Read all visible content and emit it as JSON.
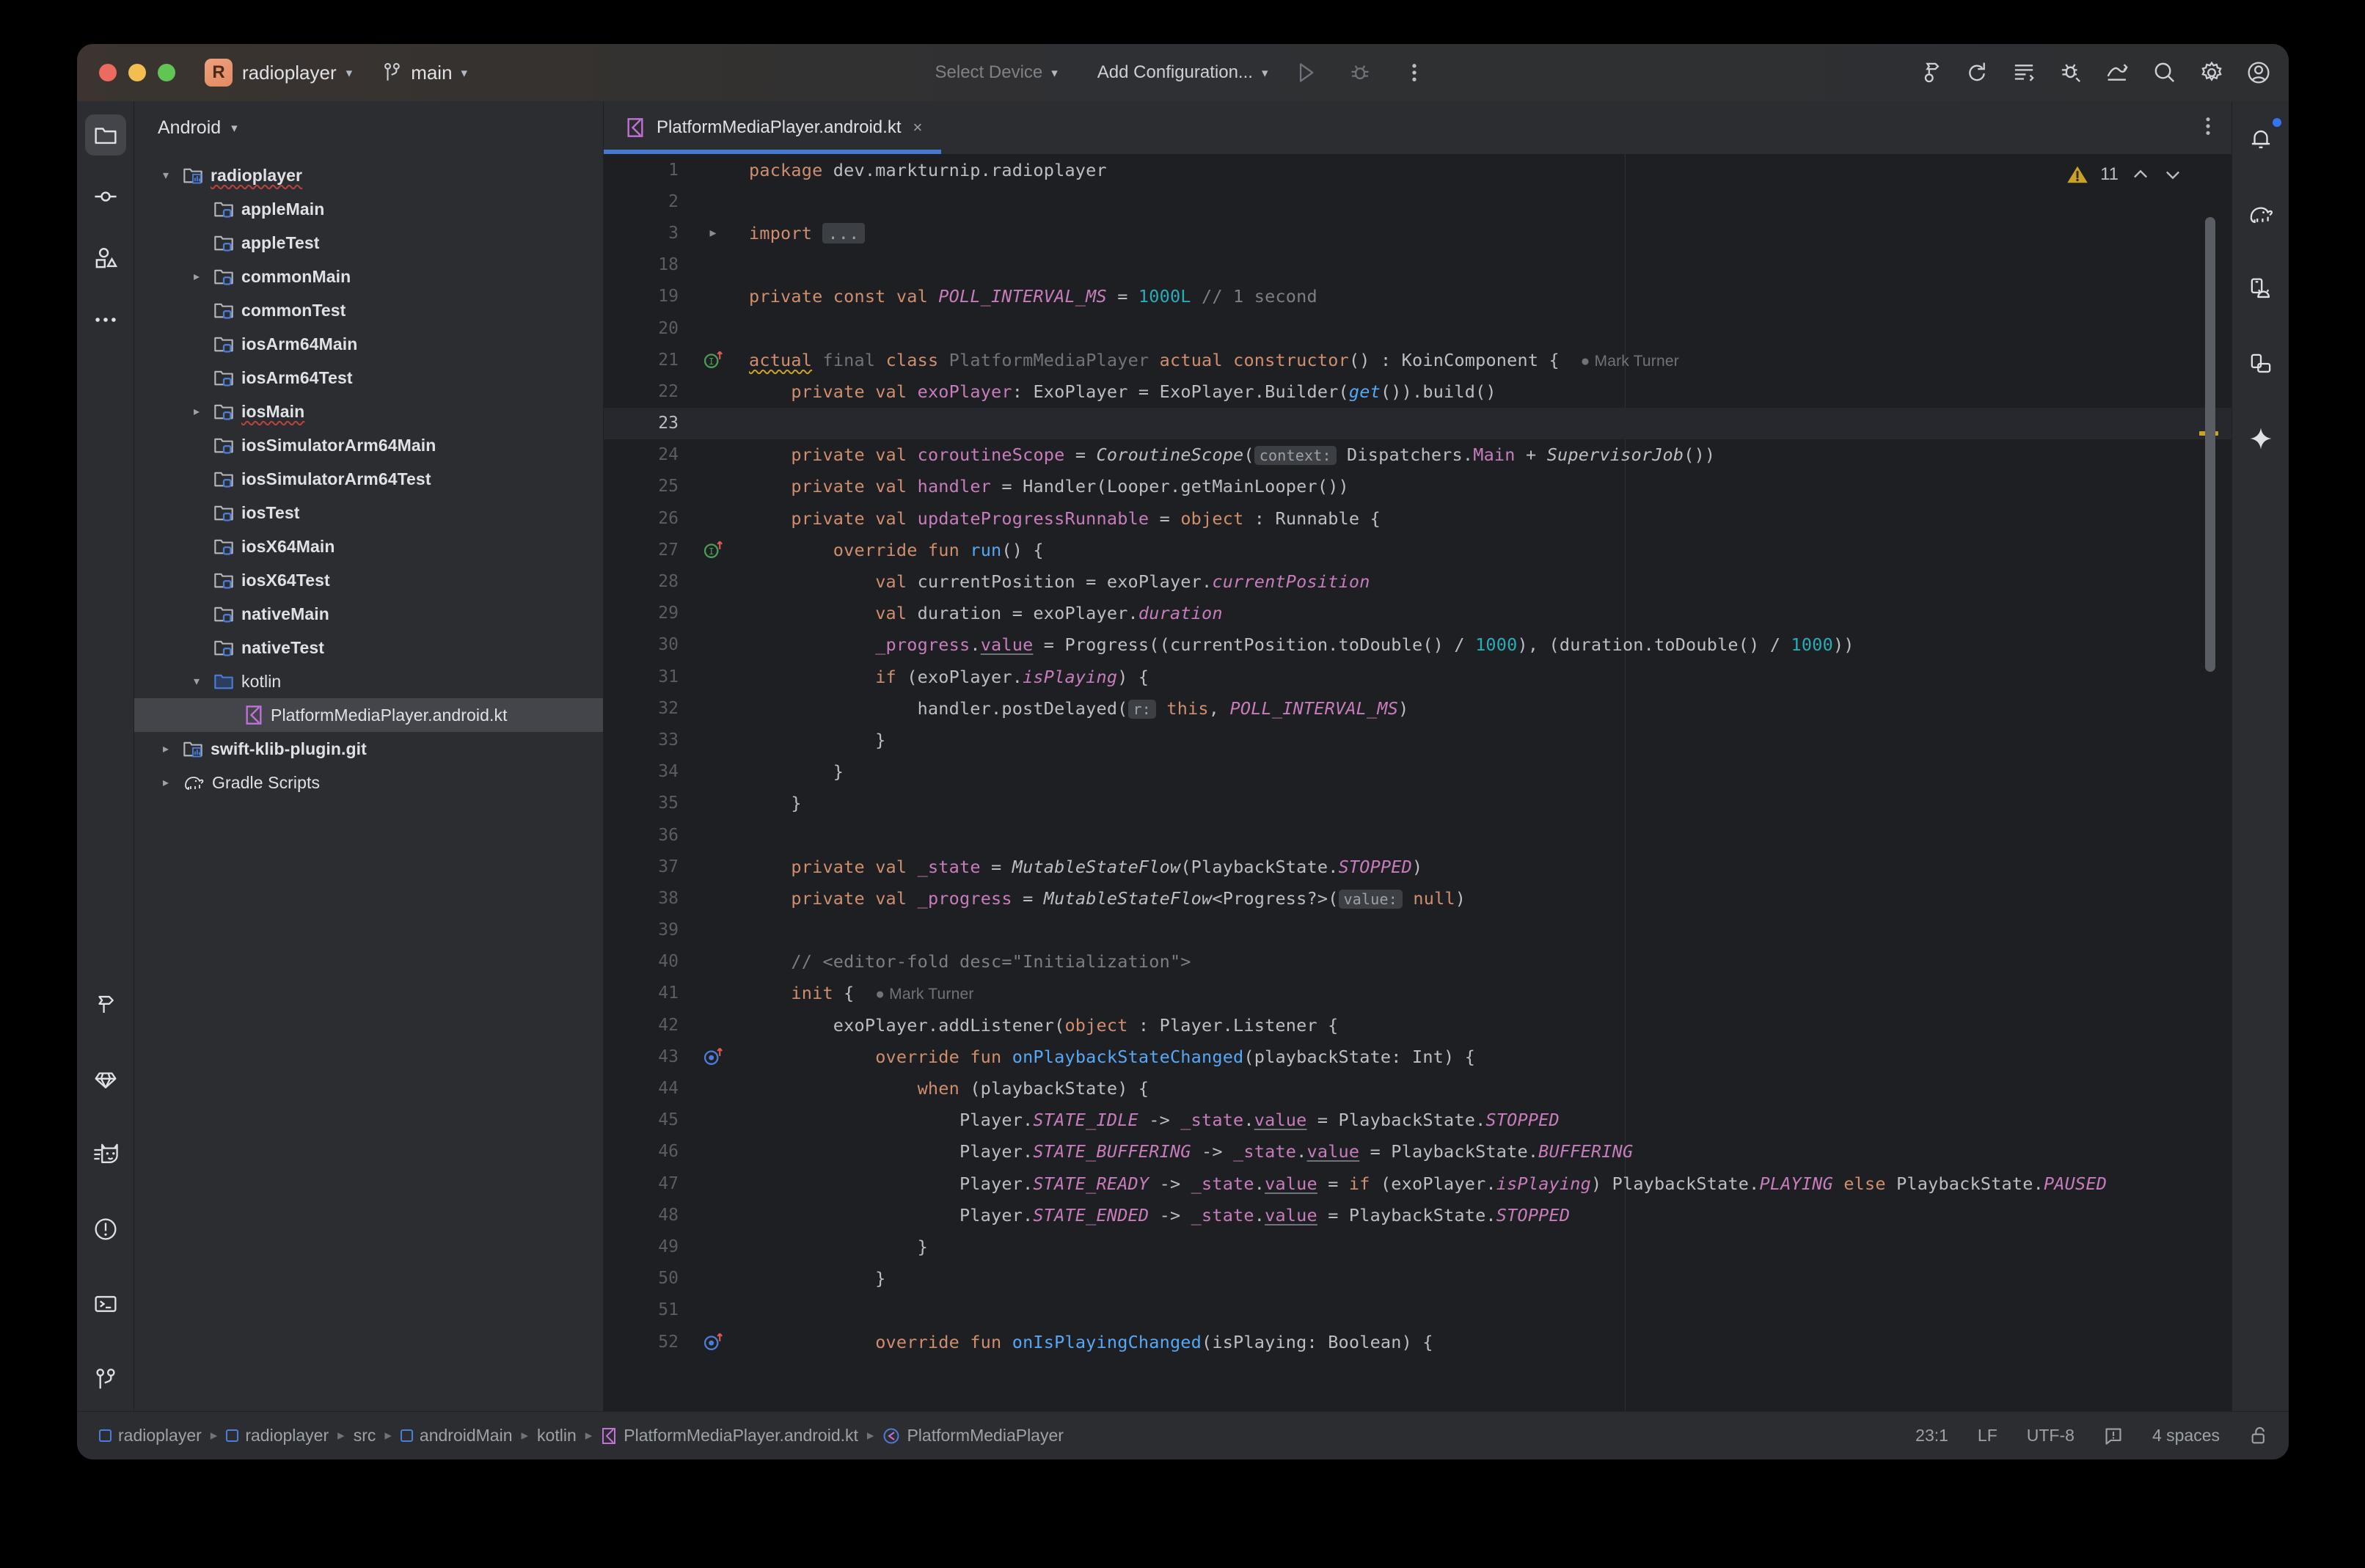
{
  "titlebar": {
    "project_badge": "R",
    "project_name": "radioplayer",
    "branch_name": "main",
    "select_device": "Select Device",
    "add_configuration": "Add Configuration...",
    "icons": {
      "run": "run-icon",
      "debug": "debug-icon",
      "more": "more-vertical-icon",
      "build": "build-hammer-icon",
      "sync": "sync-project-icon",
      "logcat": "logcat-icon",
      "profiler": "profiler-icon",
      "app_quality": "app-quality-insights-icon",
      "search": "search-icon",
      "settings": "gear-icon",
      "account": "account-icon"
    }
  },
  "left_rail": {
    "top": [
      {
        "name": "project-tool-window",
        "icon": "folder-icon",
        "active": true
      },
      {
        "name": "commit-tool-window",
        "icon": "commit-icon",
        "active": false
      },
      {
        "name": "resource-manager-tool-window",
        "icon": "resource-manager-icon",
        "active": false
      },
      {
        "name": "more-tool-windows",
        "icon": "more-horizontal-icon",
        "active": false
      }
    ],
    "bottom": [
      {
        "name": "build-tool-window",
        "icon": "hammer-icon"
      },
      {
        "name": "gradle-tool-window",
        "icon": "gem-icon"
      },
      {
        "name": "logcat-tool-window",
        "icon": "cat-icon"
      },
      {
        "name": "problems-tool-window",
        "icon": "exclamation-circle-icon"
      },
      {
        "name": "terminal-tool-window",
        "icon": "terminal-icon"
      },
      {
        "name": "git-tool-window",
        "icon": "git-branch-icon"
      }
    ]
  },
  "right_rail": [
    {
      "name": "notifications",
      "icon": "bell-icon",
      "badge": true
    },
    {
      "name": "gradle",
      "icon": "elephant-icon",
      "badge": false
    },
    {
      "name": "device-manager",
      "icon": "device-manager-icon",
      "badge": false
    },
    {
      "name": "running-devices",
      "icon": "running-devices-icon",
      "badge": false
    },
    {
      "name": "gemini",
      "icon": "sparkle-icon",
      "badge": false
    }
  ],
  "project_panel": {
    "view_label": "Android",
    "tree": [
      {
        "label": "radioplayer",
        "depth": 0,
        "twisty": "down",
        "icon": "module-folder-icon",
        "bold": true,
        "squiggle": true,
        "selected": false
      },
      {
        "label": "appleMain",
        "depth": 1,
        "twisty": "none",
        "icon": "source-folder-icon",
        "bold": true,
        "squiggle": false,
        "selected": false
      },
      {
        "label": "appleTest",
        "depth": 1,
        "twisty": "none",
        "icon": "source-folder-icon",
        "bold": true,
        "squiggle": false,
        "selected": false
      },
      {
        "label": "commonMain",
        "depth": 1,
        "twisty": "right",
        "icon": "source-folder-icon",
        "bold": true,
        "squiggle": false,
        "selected": false
      },
      {
        "label": "commonTest",
        "depth": 1,
        "twisty": "none",
        "icon": "source-folder-icon",
        "bold": true,
        "squiggle": false,
        "selected": false
      },
      {
        "label": "iosArm64Main",
        "depth": 1,
        "twisty": "none",
        "icon": "source-folder-icon",
        "bold": true,
        "squiggle": false,
        "selected": false
      },
      {
        "label": "iosArm64Test",
        "depth": 1,
        "twisty": "none",
        "icon": "source-folder-icon",
        "bold": true,
        "squiggle": false,
        "selected": false
      },
      {
        "label": "iosMain",
        "depth": 1,
        "twisty": "right",
        "icon": "source-folder-icon",
        "bold": true,
        "squiggle": true,
        "selected": false
      },
      {
        "label": "iosSimulatorArm64Main",
        "depth": 1,
        "twisty": "none",
        "icon": "source-folder-icon",
        "bold": true,
        "squiggle": false,
        "selected": false
      },
      {
        "label": "iosSimulatorArm64Test",
        "depth": 1,
        "twisty": "none",
        "icon": "source-folder-icon",
        "bold": true,
        "squiggle": false,
        "selected": false
      },
      {
        "label": "iosTest",
        "depth": 1,
        "twisty": "none",
        "icon": "source-folder-icon",
        "bold": true,
        "squiggle": false,
        "selected": false
      },
      {
        "label": "iosX64Main",
        "depth": 1,
        "twisty": "none",
        "icon": "source-folder-icon",
        "bold": true,
        "squiggle": false,
        "selected": false
      },
      {
        "label": "iosX64Test",
        "depth": 1,
        "twisty": "none",
        "icon": "source-folder-icon",
        "bold": true,
        "squiggle": false,
        "selected": false
      },
      {
        "label": "nativeMain",
        "depth": 1,
        "twisty": "none",
        "icon": "source-folder-icon",
        "bold": true,
        "squiggle": false,
        "selected": false
      },
      {
        "label": "nativeTest",
        "depth": 1,
        "twisty": "none",
        "icon": "source-folder-icon",
        "bold": true,
        "squiggle": false,
        "selected": false
      },
      {
        "label": "kotlin",
        "depth": 1,
        "twisty": "down",
        "icon": "plain-folder-icon",
        "bold": false,
        "squiggle": false,
        "selected": false
      },
      {
        "label": "PlatformMediaPlayer.android.kt",
        "depth": 2,
        "twisty": "none",
        "icon": "kotlin-file-icon",
        "bold": false,
        "squiggle": false,
        "selected": true
      },
      {
        "label": "swift-klib-plugin.git",
        "depth": 0,
        "twisty": "right",
        "icon": "module-folder-icon",
        "bold": true,
        "squiggle": false,
        "selected": false
      },
      {
        "label": "Gradle Scripts",
        "depth": 0,
        "twisty": "right",
        "icon": "elephant-icon",
        "bold": false,
        "squiggle": false,
        "selected": false
      }
    ]
  },
  "editor": {
    "tab": {
      "label": "PlatformMediaPlayer.android.kt",
      "icon": "kotlin-file-icon",
      "close": "×"
    },
    "more_icon": "more-vertical-icon",
    "inspections": {
      "warning_count": "11",
      "up": "⌃",
      "down": "⌄"
    },
    "code_vision_author": "Mark Turner"
  },
  "statusbar": {
    "breadcrumbs": [
      {
        "label": "radioplayer",
        "icon": "module-icon"
      },
      {
        "label": "radioplayer",
        "icon": "module-icon"
      },
      {
        "label": "src",
        "icon": "none"
      },
      {
        "label": "androidMain",
        "icon": "module-icon"
      },
      {
        "label": "kotlin",
        "icon": "none"
      },
      {
        "label": "PlatformMediaPlayer.android.kt",
        "icon": "kotlin-file-icon"
      },
      {
        "label": "PlatformMediaPlayer",
        "icon": "kotlin-class-icon"
      }
    ],
    "caret_position": "23:1",
    "line_separator": "LF",
    "encoding": "UTF-8",
    "inspection_icon": "inspection-widget-icon",
    "indent": "4 spaces",
    "lock_icon": "unlocked-icon"
  },
  "colors": {
    "accent": "#3574F0",
    "tab_underline": "#4878CF",
    "warning": "#C9A227",
    "editor_bg": "#1E1F22",
    "panel_bg": "#2B2D30",
    "selection": "#43454A"
  }
}
